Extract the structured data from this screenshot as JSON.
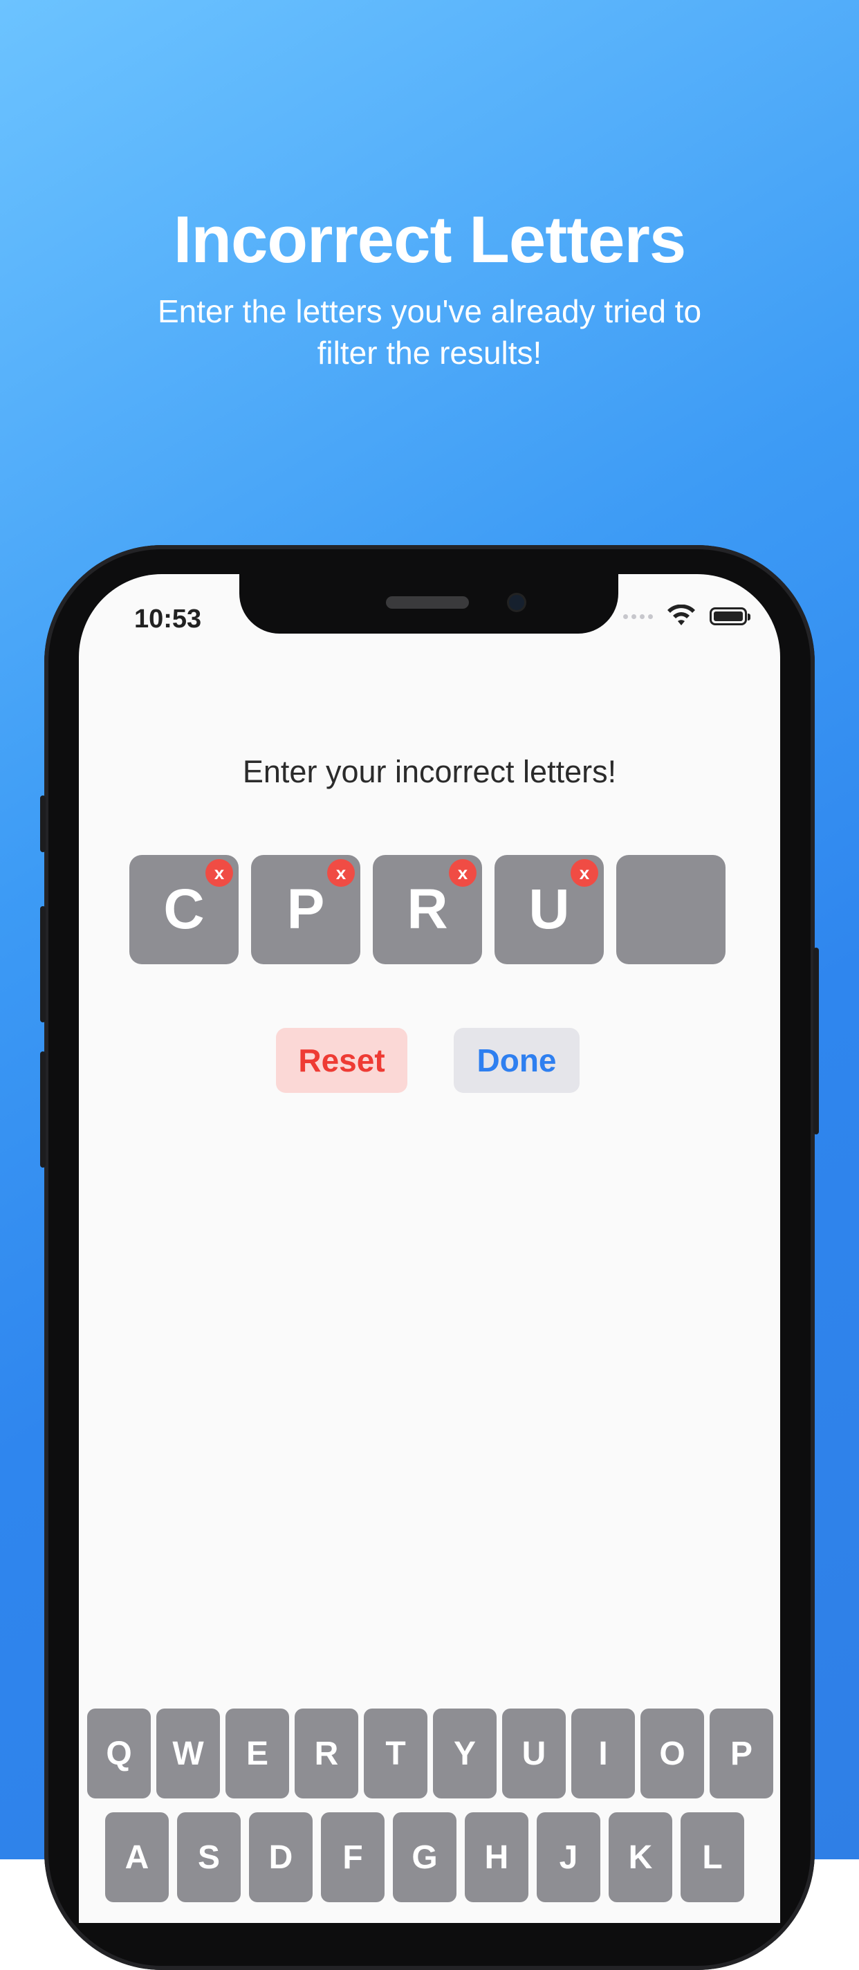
{
  "hero": {
    "title": "Incorrect Letters",
    "subtitle": "Enter the letters you've already tried to filter the results!"
  },
  "status_bar": {
    "time": "10:53",
    "icons": [
      "signal-icon",
      "wifi-icon",
      "battery-icon"
    ]
  },
  "screen": {
    "prompt": "Enter your incorrect letters!",
    "tiles": [
      {
        "letter": "C",
        "remove": "x"
      },
      {
        "letter": "P",
        "remove": "x"
      },
      {
        "letter": "R",
        "remove": "x"
      },
      {
        "letter": "U",
        "remove": "x"
      },
      {
        "letter": ""
      }
    ],
    "reset_label": "Reset",
    "done_label": "Done"
  },
  "keyboard": {
    "row1": [
      "Q",
      "W",
      "E",
      "R",
      "T",
      "Y",
      "U",
      "I",
      "O",
      "P"
    ],
    "row2": [
      "A",
      "S",
      "D",
      "F",
      "G",
      "H",
      "J",
      "K",
      "L"
    ]
  },
  "colors": {
    "background_gradient": [
      "#6cc3ff",
      "#2f7fe6"
    ],
    "tile": "#8e8e93",
    "remove_badge": "#f04c44",
    "reset_text": "#ee3b34",
    "reset_bg": "#fbd8d6",
    "done_text": "#2e7ff0",
    "done_bg": "#e5e5ea"
  }
}
